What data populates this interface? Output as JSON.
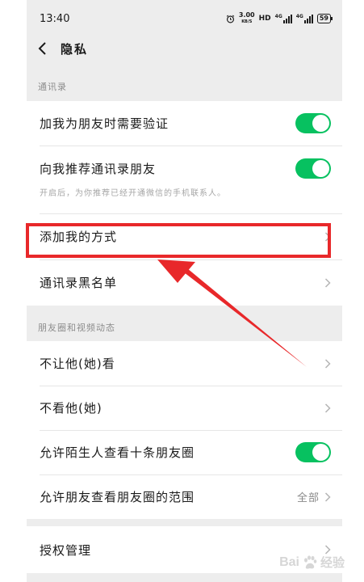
{
  "status_bar": {
    "time": "13:40",
    "net_speed_value": "3.00",
    "net_speed_unit": "KB/S",
    "hd_label": "HD",
    "signal1_label": "4G",
    "signal2_label": "4G",
    "battery_level": "59"
  },
  "nav": {
    "title": "隐私"
  },
  "sections": {
    "contacts": {
      "header": "通讯录",
      "verify_label": "加我为朋友时需要验证",
      "recommend_label": "向我推荐通讯录朋友",
      "recommend_hint": "开启后，为你推荐已经开通微信的手机联系人。",
      "add_methods_label": "添加我的方式",
      "blacklist_label": "通讯录黑名单"
    },
    "moments": {
      "header": "朋友圈和视频动态",
      "hide_mine_label": "不让他(她)看",
      "hide_theirs_label": "不看他(她)",
      "strangers_label": "允许陌生人查看十条朋友圈",
      "range_label": "允许朋友查看朋友圈的范围",
      "range_value": "全部"
    },
    "auth": {
      "label": "授权管理"
    }
  },
  "toggles": {
    "verify_on": true,
    "recommend_on": true,
    "strangers_on": true
  },
  "watermark": {
    "brand": "Bai",
    "brand_cn": "经验"
  },
  "colors": {
    "toggle_on": "#07c160",
    "highlight": "#e8282a",
    "background": "#ededed"
  }
}
